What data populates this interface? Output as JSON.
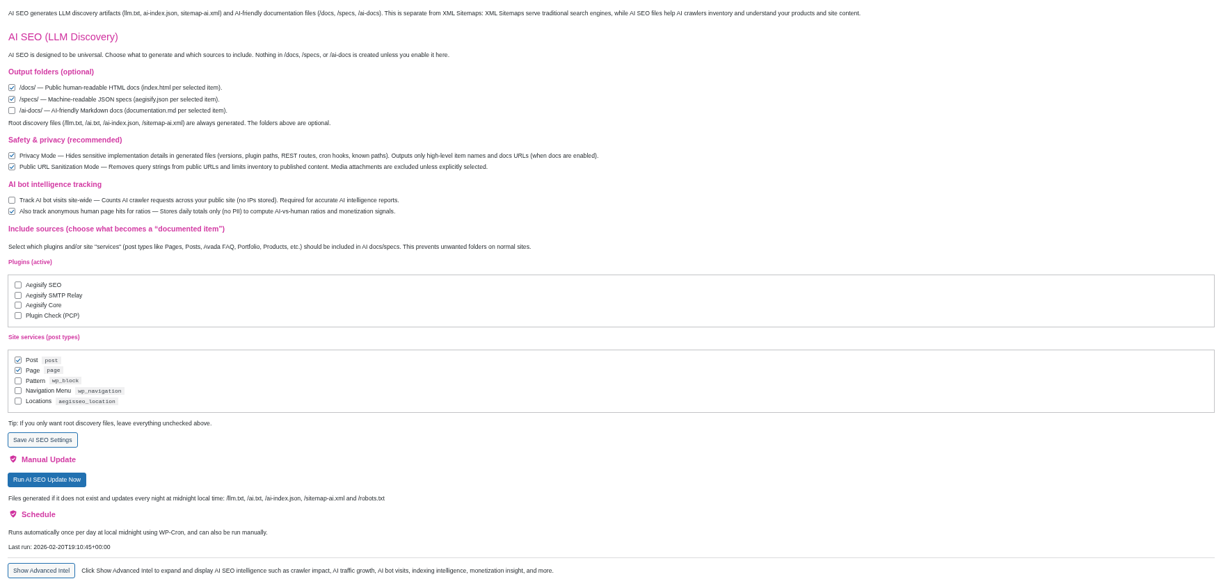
{
  "intro": "AI SEO generates LLM discovery artifacts (llm.txt, ai-index.json, sitemap-ai.xml) and AI-friendly documentation files (/docs, /specs, /ai-docs). This is separate from XML Sitemaps: XML Sitemaps serve traditional search engines, while AI SEO files help AI crawlers inventory and understand your products and site content.",
  "title": "AI SEO (LLM Discovery)",
  "description": "AI SEO is designed to be universal. Choose what to generate and which sources to include. Nothing in /docs, /specs, or /ai-docs is created unless you enable it here.",
  "settings": [
    {
      "heading": "Output folders (optional)",
      "options": [
        {
          "label": "/docs/ — Public human-readable HTML docs (index.html per selected item).",
          "checked": true
        },
        {
          "label": "/specs/ — Machine-readable JSON specs (aegisify.json per selected item).",
          "checked": true
        },
        {
          "label": "/ai-docs/ — AI-friendly Markdown docs (documentation.md per selected item).",
          "checked": false
        }
      ],
      "note": "Root discovery files (/llm.txt, /ai.txt, /ai-index.json, /sitemap-ai.xml) are always generated. The folders above are optional."
    },
    {
      "heading": "Safety & privacy (recommended)",
      "options": [
        {
          "label": "Privacy Mode — Hides sensitive implementation details in generated files (versions, plugin paths, REST routes, cron hooks, known paths). Outputs only high-level item names and docs URLs (when docs are enabled).",
          "checked": true
        },
        {
          "label": "Public URL Sanitization Mode — Removes query strings from public URLs and limits inventory to published content. Media attachments are excluded unless explicitly selected.",
          "checked": true
        }
      ]
    },
    {
      "heading": "AI bot intelligence tracking",
      "options": [
        {
          "label": "Track AI bot visits site-wide — Counts AI crawler requests across your public site (no IPs stored). Required for accurate AI intelligence reports.",
          "checked": false
        },
        {
          "label": "Also track anonymous human page hits for ratios — Stores daily totals only (no PII) to compute AI-vs-human ratios and monetization signals.",
          "checked": true
        }
      ]
    }
  ],
  "include_sources": {
    "heading": "Include sources (choose what becomes a “documented item”)",
    "description": "Select which plugins and/or site \"services\" (post types like Pages, Posts, Avada FAQ, Portfolio, Products, etc.) should be included in AI docs/specs. This prevents unwanted folders on normal sites.",
    "groups": [
      {
        "label": "Plugins (active)",
        "items": [
          {
            "label": "Aegisify SEO",
            "checked": false
          },
          {
            "label": "Aegisify SMTP Relay",
            "checked": false
          },
          {
            "label": "Aegisify Core",
            "checked": false
          },
          {
            "label": "Plugin Check (PCP)",
            "checked": false
          }
        ]
      },
      {
        "label": "Site services (post types)",
        "items": [
          {
            "label": "Post",
            "slug": "post",
            "checked": true
          },
          {
            "label": "Page",
            "slug": "page",
            "checked": true
          },
          {
            "label": "Pattern",
            "slug": "wp_block",
            "checked": false
          },
          {
            "label": "Navigation Menu",
            "slug": "wp_navigation",
            "checked": false
          },
          {
            "label": "Locations",
            "slug": "aegisseo_location",
            "checked": false
          }
        ]
      }
    ],
    "tip": "Tip: If you only want root discovery files, leave everything unchecked above.",
    "save_button": "Save AI SEO Settings"
  },
  "manual_update": {
    "heading": "Manual Update",
    "button": "Run AI SEO Update Now",
    "note": "Files generated if it does not exist and updates every night at midnight local time: /llm.txt, /ai.txt, /ai-index.json, /sitemap-ai.xml and /robots.txt"
  },
  "schedule": {
    "heading": "Schedule",
    "description": "Runs automatically once per day at local midnight using WP-Cron, and can also be run manually.",
    "last_run": "Last run: 2026-02-20T19:10:45+00:00"
  },
  "advanced": {
    "button": "Show Advanced Intel",
    "hint": "Click Show Advanced Intel to expand and display AI SEO intelligence such as crawler impact, AI traffic growth, AI bot visits, indexing intelligence, monetization insight, and more."
  }
}
